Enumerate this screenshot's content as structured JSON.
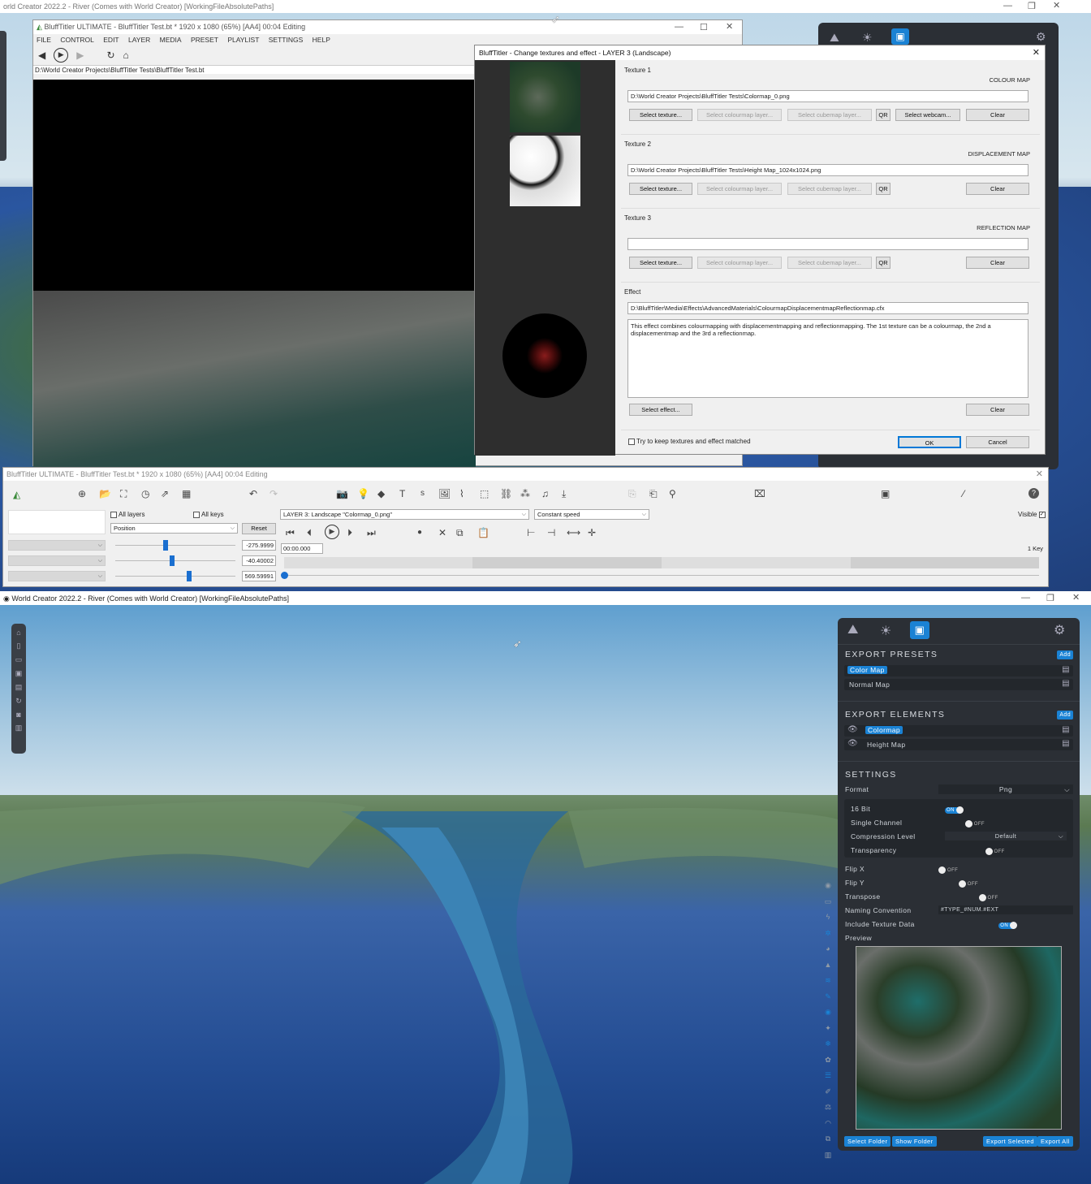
{
  "wc_top": {
    "title": "orld Creator 2022.2   -   River (Comes with World Creator)   [WorkingFileAbsolutePaths]"
  },
  "bt_main": {
    "title": "BluffTitler ULTIMATE  - BluffTitler Test.bt * 1920 x 1080 (65%) [AA4] 00:04 Editing",
    "menu": [
      "FILE",
      "CONTROL",
      "EDIT",
      "LAYER",
      "MEDIA",
      "PRESET",
      "PLAYLIST",
      "SETTINGS",
      "HELP"
    ],
    "path": "D:\\World Creator Projects\\BluffTitler Tests\\BluffTitler Test.bt"
  },
  "dialog": {
    "title": "BluffTitler - Change textures and effect - LAYER 3 (Landscape)",
    "texture1": {
      "label": "Texture 1",
      "kind": "COLOUR MAP",
      "value": "D:\\World Creator Projects\\BluffTitler Tests\\Colormap_0.png"
    },
    "texture2": {
      "label": "Texture 2",
      "kind": "DISPLACEMENT MAP",
      "value": "D:\\World Creator Projects\\BluffTitler Tests\\Height Map_1024x1024.png"
    },
    "texture3": {
      "label": "Texture 3",
      "kind": "REFLECTION MAP",
      "value": ""
    },
    "btn_select_texture": "Select texture...",
    "btn_select_colourmap": "Select colourmap layer...",
    "btn_select_cubemap": "Select cubemap layer...",
    "btn_qr": "QR",
    "btn_webcam": "Select webcam...",
    "btn_clear": "Clear",
    "effect": {
      "label": "Effect",
      "value": "D:\\BluffTitler\\Media\\Effects\\AdvancedMaterials\\ColourmapDisplacementmapReflectionmap.cfx",
      "description": "This effect combines colourmapping with displacementmapping and reflectionmapping. The 1st texture can be a colourmap, the 2nd a displacementmap and the 3rd a reflectionmap.",
      "select": "Select effect..."
    },
    "keep_matched": "Try to keep textures and effect matched",
    "ok": "OK",
    "cancel": "Cancel"
  },
  "bt_panel": {
    "title": "BluffTitler ULTIMATE  - BluffTitler Test.bt * 1920 x 1080 (65%) [AA4] 00:04 Editing",
    "all_layers": "All layers",
    "all_keys": "All keys",
    "property": "Position",
    "reset": "Reset",
    "layer": "LAYER 3: Landscape \"Colormap_0.png\"",
    "speed": "Constant speed",
    "visible": "Visible",
    "values": [
      "-275.9999",
      "-40.40002",
      "569.59991"
    ],
    "time": "00:00.000",
    "keys": "1 Key"
  },
  "wc_bot": {
    "title": "World Creator 2022.2   -   River (Comes with World Creator)   [WorkingFileAbsolutePaths]"
  },
  "export": {
    "presets_title": "EXPORT PRESETS",
    "add": "Add",
    "presets": [
      "Color Map",
      "Normal Map"
    ],
    "elements_title": "EXPORT ELEMENTS",
    "elements": [
      "Colormap",
      "Height Map"
    ],
    "settings_title": "SETTINGS",
    "format_label": "Format",
    "format_value": "Png",
    "bit16": "16 Bit",
    "single_channel": "Single Channel",
    "compression": "Compression Level",
    "compression_value": "Default",
    "transparency": "Transparency",
    "flipx": "Flip X",
    "flipy": "Flip Y",
    "transpose": "Transpose",
    "naming": "Naming Convention",
    "naming_value": "#TYPE_#NUM.#EXT",
    "include_texture": "Include Texture Data",
    "preview": "Preview",
    "on": "ON",
    "off": "OFF",
    "select_folder": "Select Folder",
    "show_folder": "Show Folder",
    "export_selected": "Export Selected",
    "export_all": "Export All"
  },
  "colors": {
    "accent": "#1a82d4",
    "panel": "#2b2f35"
  }
}
